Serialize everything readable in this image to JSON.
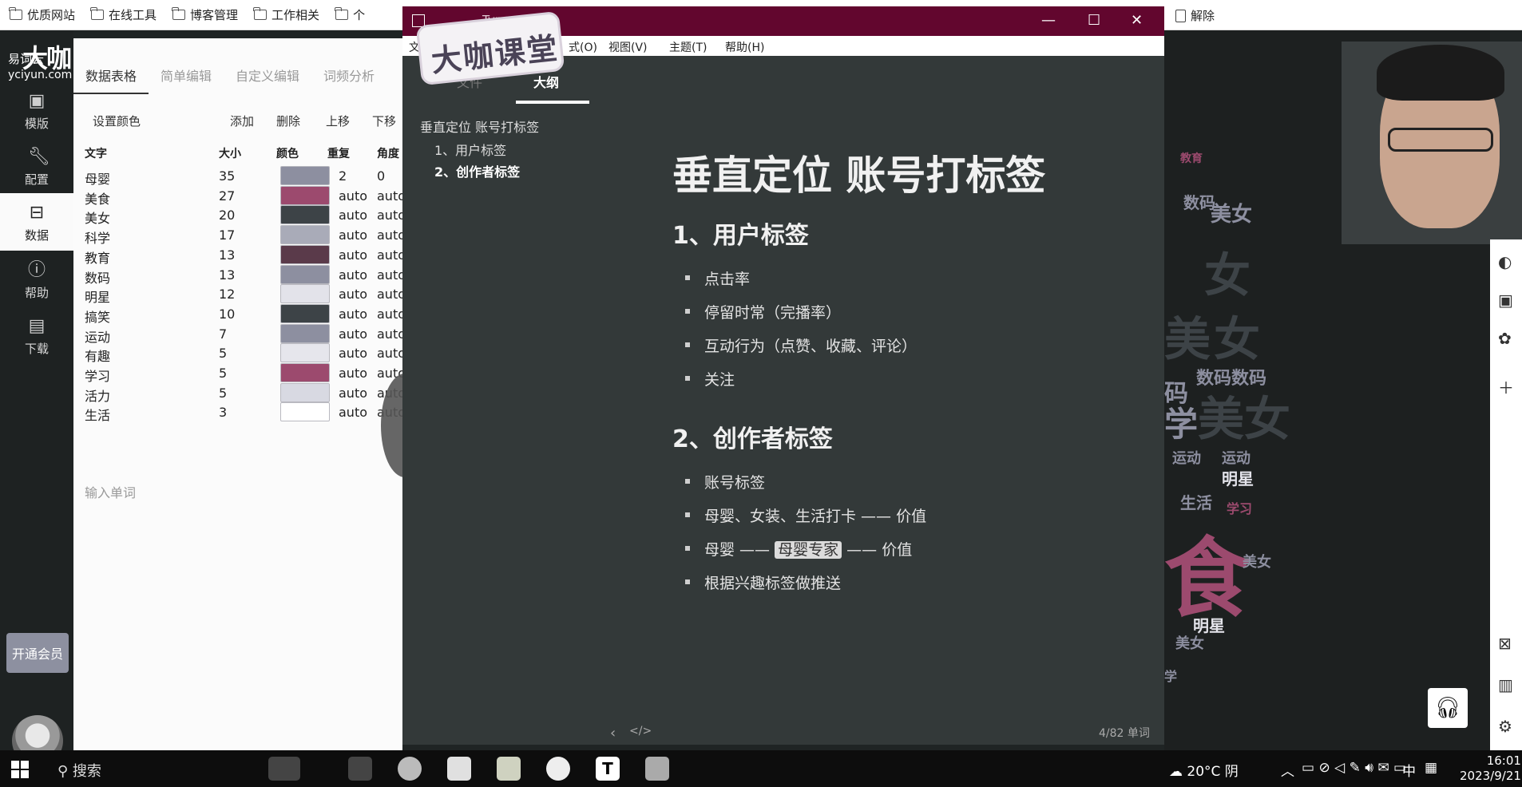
{
  "bookmarks": {
    "items": [
      "优质网站",
      "在线工具",
      "博客管理",
      "工作相关",
      "个"
    ],
    "right_item": "解除"
  },
  "rail": {
    "brand_big": "大咖",
    "brand_name": "易词云",
    "brand_domain": "yciyun.com",
    "items": [
      {
        "label": "模版",
        "icon": "template-icon"
      },
      {
        "label": "配置",
        "icon": "wrench-icon"
      },
      {
        "label": "数据",
        "icon": "inbox-icon"
      },
      {
        "label": "帮助",
        "icon": "help-icon"
      },
      {
        "label": "下载",
        "icon": "save-icon"
      }
    ],
    "member_button": "开通会员"
  },
  "panel": {
    "tabs": [
      "数据表格",
      "简单编辑",
      "自定义编辑",
      "词频分析"
    ],
    "toolbar": {
      "set_color": "设置颜色",
      "add": "添加",
      "delete": "删除",
      "move_up": "上移",
      "move_down": "下移"
    },
    "columns": [
      "文字",
      "大小",
      "颜色",
      "重复",
      "角度"
    ],
    "rows": [
      {
        "word": "母婴",
        "size": "35",
        "color": "#8d8fa0",
        "repeat": "2",
        "angle": "0"
      },
      {
        "word": "美食",
        "size": "27",
        "color": "#9c4a6e",
        "repeat": "auto",
        "angle": "auto"
      },
      {
        "word": "美女",
        "size": "20",
        "color": "#3d4347",
        "repeat": "auto",
        "angle": "auto"
      },
      {
        "word": "科学",
        "size": "17",
        "color": "#a9abb8",
        "repeat": "auto",
        "angle": "auto"
      },
      {
        "word": "教育",
        "size": "13",
        "color": "#5a3a4a",
        "repeat": "auto",
        "angle": "auto"
      },
      {
        "word": "数码",
        "size": "13",
        "color": "#8d8fa0",
        "repeat": "auto",
        "angle": "auto"
      },
      {
        "word": "明星",
        "size": "12",
        "color": "#e3e3ea",
        "repeat": "auto",
        "angle": "auto"
      },
      {
        "word": "搞笑",
        "size": "10",
        "color": "#3d4347",
        "repeat": "auto",
        "angle": "auto"
      },
      {
        "word": "运动",
        "size": "7",
        "color": "#8d8fa0",
        "repeat": "auto",
        "angle": "auto"
      },
      {
        "word": "有趣",
        "size": "5",
        "color": "#e6e6ec",
        "repeat": "auto",
        "angle": "auto"
      },
      {
        "word": "学习",
        "size": "5",
        "color": "#9c4a6e",
        "repeat": "auto",
        "angle": "auto"
      },
      {
        "word": "活力",
        "size": "5",
        "color": "#d8d9e2",
        "repeat": "auto",
        "angle": "auto"
      },
      {
        "word": "生活",
        "size": "3",
        "color": "#ffffff",
        "repeat": "auto",
        "angle": "auto"
      }
    ],
    "input_placeholder": "输入单词"
  },
  "typora": {
    "window_title": "Typora",
    "menu": [
      "文",
      "式(O)",
      "视图(V)",
      "主题(T)",
      "帮助(H)"
    ],
    "logo_text": "大咖课堂",
    "sidebar_tabs": {
      "files": "文件",
      "outline": "大纲"
    },
    "outline": [
      "垂直定位 账号打标签",
      "1、用户标签",
      "2、创作者标签"
    ],
    "doc": {
      "h1": "垂直定位 账号打标签",
      "section1": {
        "title": "1、用户标签",
        "items": [
          "点击率",
          "停留时常（完播率）",
          "互动行为（点赞、收藏、评论）",
          "关注"
        ]
      },
      "section2": {
        "title": "2、创作者标签",
        "items": [
          "账号标签",
          "母婴、女装、生活打卡 —— 价值"
        ],
        "item3_prefix": "母婴 ——",
        "item3_highlight": "母婴专家",
        "item3_suffix": "—— 价值",
        "item4": "根据兴趣标签做推送"
      }
    },
    "status": {
      "word_count": "4/82 单词"
    }
  },
  "cloud": {
    "words": [
      "码",
      "女",
      "美女",
      "美",
      "女",
      "数码数码",
      "学",
      "美",
      "女",
      "运动",
      "运动",
      "明星",
      "生活",
      "学习",
      "食",
      "美女",
      "明星",
      "美女",
      "学",
      "数码",
      "教育"
    ]
  },
  "taskbar": {
    "search": "搜索",
    "weather": "20°C 阴",
    "ime": "中",
    "time": "16:01",
    "date": "2023/9/21"
  },
  "colors": {
    "typora_titlebar": "#62062e",
    "accent_pink": "#9c4a6e",
    "member_button": "#8d90a0"
  }
}
